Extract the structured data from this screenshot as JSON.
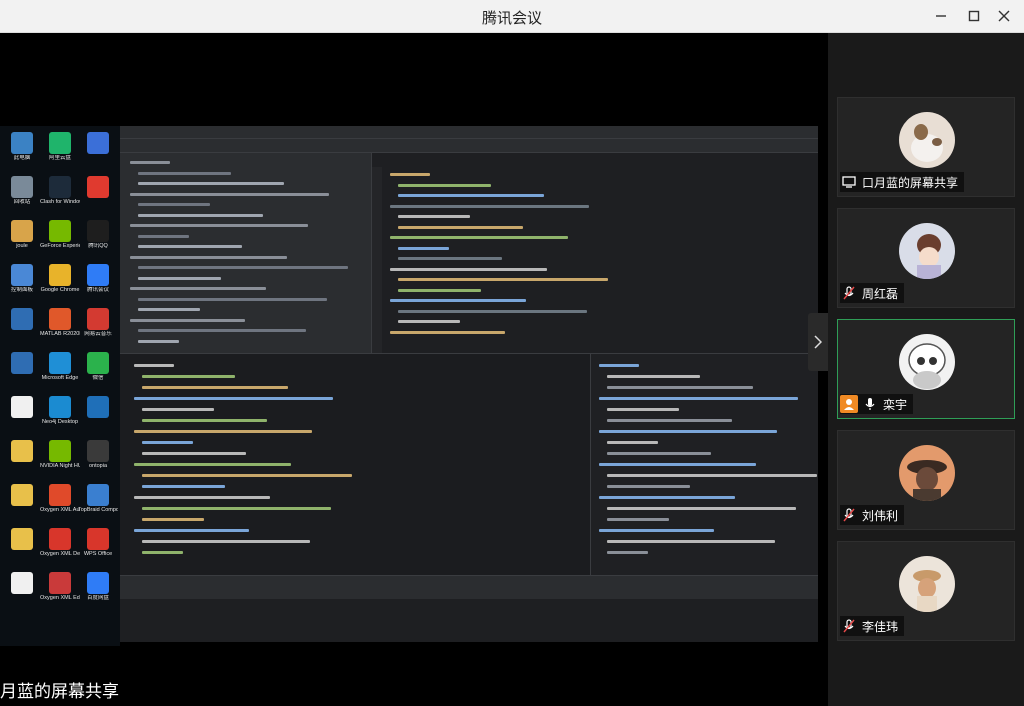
{
  "window": {
    "title": "腾讯会议",
    "controls": {
      "minimize": "minimize",
      "maximize": "maximize",
      "close": "close"
    }
  },
  "share": {
    "label": "月蓝的屏幕共享",
    "desktop_icons": [
      {
        "label": "此电脑",
        "color": "#3b82c4"
      },
      {
        "label": "阿里云盘",
        "color": "#1fb46b"
      },
      {
        "label": "",
        "color": "#3b6fd8"
      },
      {
        "label": "回收站",
        "color": "#7a8a99"
      },
      {
        "label": "Clash for Windows",
        "color": "#1d2b3a"
      },
      {
        "label": "",
        "color": "#e03a2f"
      },
      {
        "label": "joule",
        "color": "#d8a44a"
      },
      {
        "label": "GeForce Experience",
        "color": "#76b900"
      },
      {
        "label": "腾讯QQ",
        "color": "#1e1e1e"
      },
      {
        "label": "控制面板",
        "color": "#4a88d6"
      },
      {
        "label": "Google Chrome",
        "color": "#e8b32a"
      },
      {
        "label": "腾讯会议",
        "color": "#2f7cf6"
      },
      {
        "label": "",
        "color": "#2f6db3"
      },
      {
        "label": "MATLAB R2020b",
        "color": "#e0582a"
      },
      {
        "label": "网易云音乐",
        "color": "#d33a31"
      },
      {
        "label": "",
        "color": "#2f6db3"
      },
      {
        "label": "Microsoft Edge",
        "color": "#1f8fd6"
      },
      {
        "label": "微信",
        "color": "#2bb24c"
      },
      {
        "label": "",
        "color": "#f0f0f0"
      },
      {
        "label": "Neo4j Desktop",
        "color": "#1b8bd1"
      },
      {
        "label": "",
        "color": "#1f6fb8"
      },
      {
        "label": "",
        "color": "#e8c04a"
      },
      {
        "label": "NVIDIA Night HU...",
        "color": "#76b900"
      },
      {
        "label": "ontopia",
        "color": "#3a3a3a"
      },
      {
        "label": "",
        "color": "#e8c04a"
      },
      {
        "label": "Oxygen XML Auth...",
        "color": "#e04a2a"
      },
      {
        "label": "TopBraid Composer...",
        "color": "#3a7fd0"
      },
      {
        "label": "",
        "color": "#e8c04a"
      },
      {
        "label": "Oxygen XML De...",
        "color": "#d8362b"
      },
      {
        "label": "WPS Office",
        "color": "#d8362b"
      },
      {
        "label": "",
        "color": "#f0f0f0"
      },
      {
        "label": "Oxygen XML Edit...",
        "color": "#c93a3a"
      },
      {
        "label": "百度网盘",
        "color": "#2f7cf6"
      }
    ]
  },
  "participants": [
    {
      "name": "口月蓝的屏幕共享",
      "icon": "screen-share-icon",
      "muted": false,
      "active": false
    },
    {
      "name": "周红磊",
      "icon": "mic-muted-icon",
      "muted": true,
      "active": false
    },
    {
      "name": "栾宇",
      "icon": "mic-icon",
      "muted": false,
      "active": true
    },
    {
      "name": "刘伟利",
      "icon": "mic-muted-icon",
      "muted": true,
      "active": false
    },
    {
      "name": "李佳玮",
      "icon": "mic-muted-icon",
      "muted": true,
      "active": false
    }
  ],
  "colors": {
    "accent": "#2f9e57",
    "presenter": "#f08a24"
  }
}
